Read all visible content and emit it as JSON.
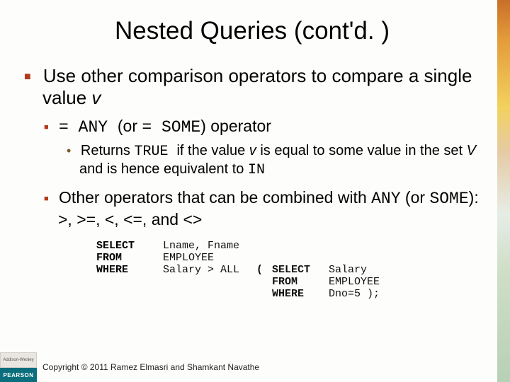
{
  "title": "Nested Queries (cont'd. )",
  "bullet1_a": "Use other comparison operators to compare a single value ",
  "bullet1_v": "v",
  "b2_eq1": "= ANY ",
  "b2_or": " (or ",
  "b2_eq2": "= SOME",
  "b2_tail": ") operator",
  "b3_a": "Returns ",
  "b3_true": "TRUE ",
  "b3_b": " if the value ",
  "b3_v": "v",
  "b3_c": " is equal to some value in the set ",
  "b3_V": "V",
  "b3_d": " and is hence equivalent to ",
  "b3_in": "IN",
  "b4_a": "Other operators that can be combined with ",
  "b4_any": "ANY",
  "b4_b": " (or ",
  "b4_some": "SOME",
  "b4_c": "): >, >=, <, <=, and <>",
  "code": {
    "r1k": "SELECT",
    "r1a": "Lname, Fname",
    "r2k": "FROM",
    "r2a": "EMPLOYEE",
    "r3k": "WHERE",
    "r3a": "Salary > ALL",
    "r3b": "(",
    "s1k": "SELECT",
    "s1a": "Salary",
    "s2k": "FROM",
    "s2a": "EMPLOYEE",
    "s3k": "WHERE",
    "s3a": "Dno=5 );"
  },
  "logo_top": "Addison-Wesley",
  "logo_bot": "PEARSON",
  "copyright": "Copyright © 2011 Ramez Elmasri and Shamkant Navathe"
}
